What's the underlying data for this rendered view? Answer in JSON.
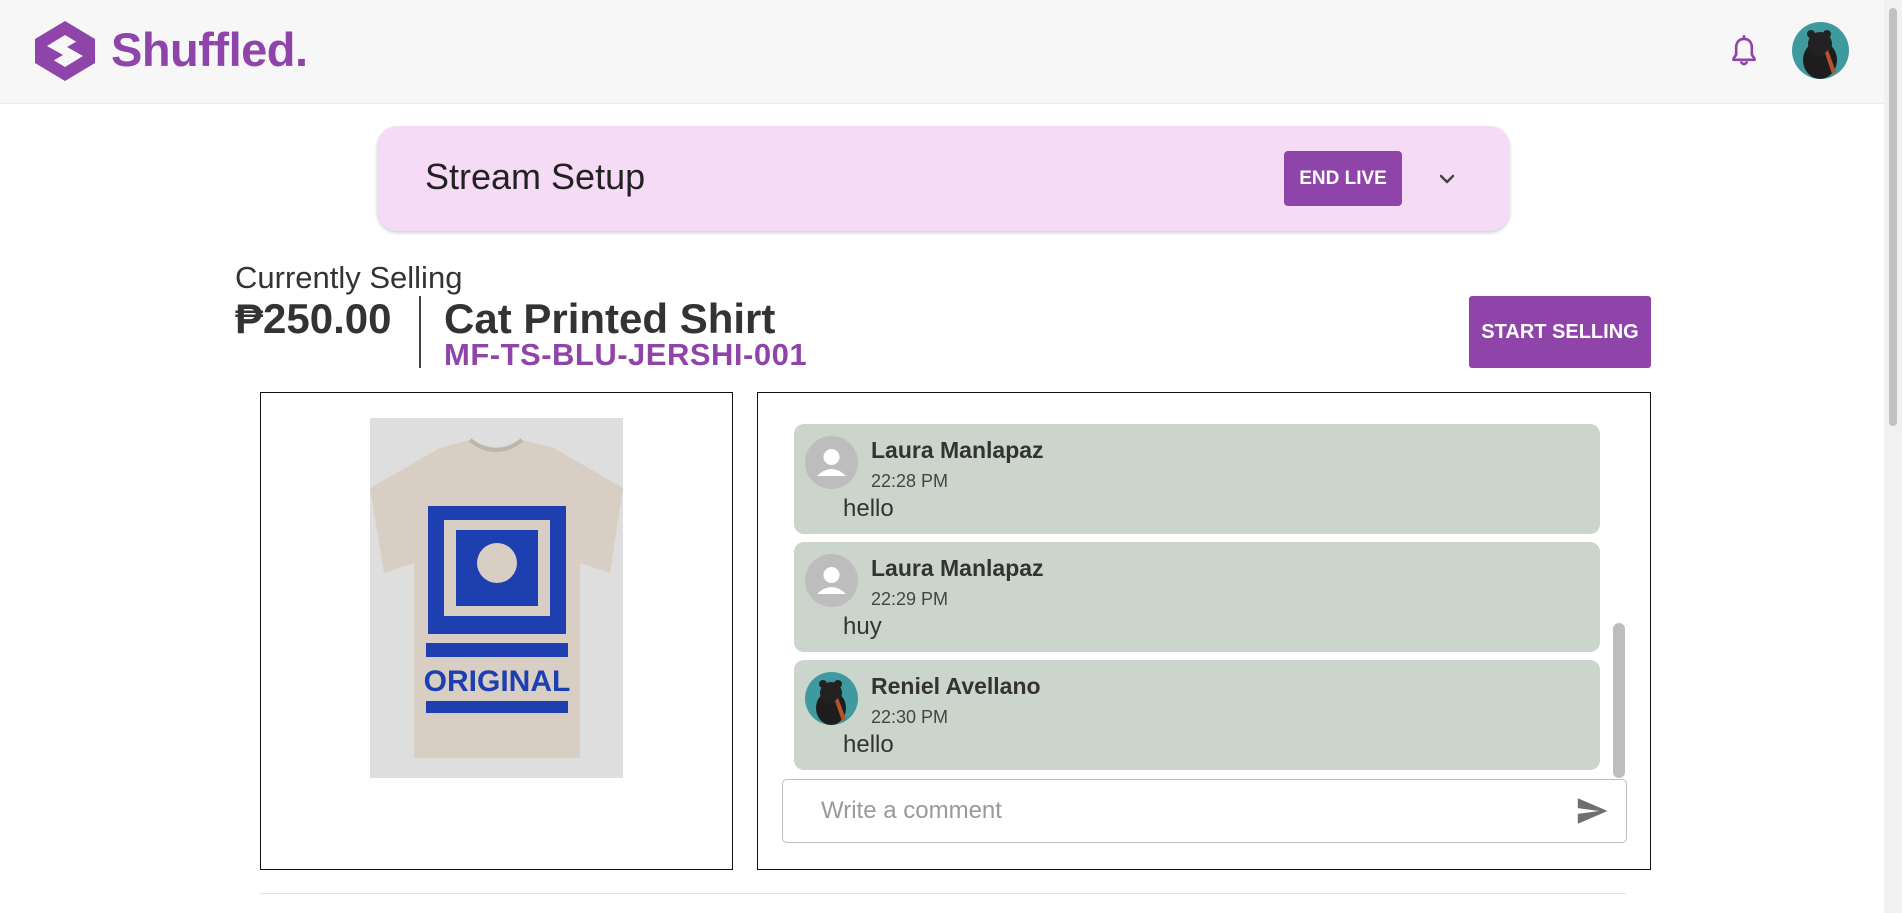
{
  "header": {
    "brand": "Shuffled.",
    "brand_color": "#8e44a8",
    "icons": [
      "shuffled-logo-icon",
      "bell-icon",
      "user-avatar"
    ]
  },
  "stream_setup": {
    "title": "Stream Setup",
    "end_live_label": "END LIVE",
    "expand_icon": "chevron-down-icon",
    "background": "#f5dbf6"
  },
  "product": {
    "section_label": "Currently Selling",
    "price": "₱250.00",
    "name": "Cat Printed Shirt",
    "sku": "MF-TS-BLU-JERSHI-001",
    "start_selling_label": "START SELLING",
    "image_text": "ORIGINAL"
  },
  "chat": {
    "messages": [
      {
        "author": "Laura Manlapaz",
        "time": "22:28 PM",
        "text": "hello",
        "avatar": "default-user-icon"
      },
      {
        "author": "Laura Manlapaz",
        "time": "22:29 PM",
        "text": "huy",
        "avatar": "default-user-icon"
      },
      {
        "author": "Reniel Avellano",
        "time": "22:30 PM",
        "text": "hello",
        "avatar": "user-photo"
      }
    ],
    "input_placeholder": "Write a comment",
    "input_value": "",
    "send_icon": "send-icon",
    "bubble_color": "#cbd5cc"
  }
}
